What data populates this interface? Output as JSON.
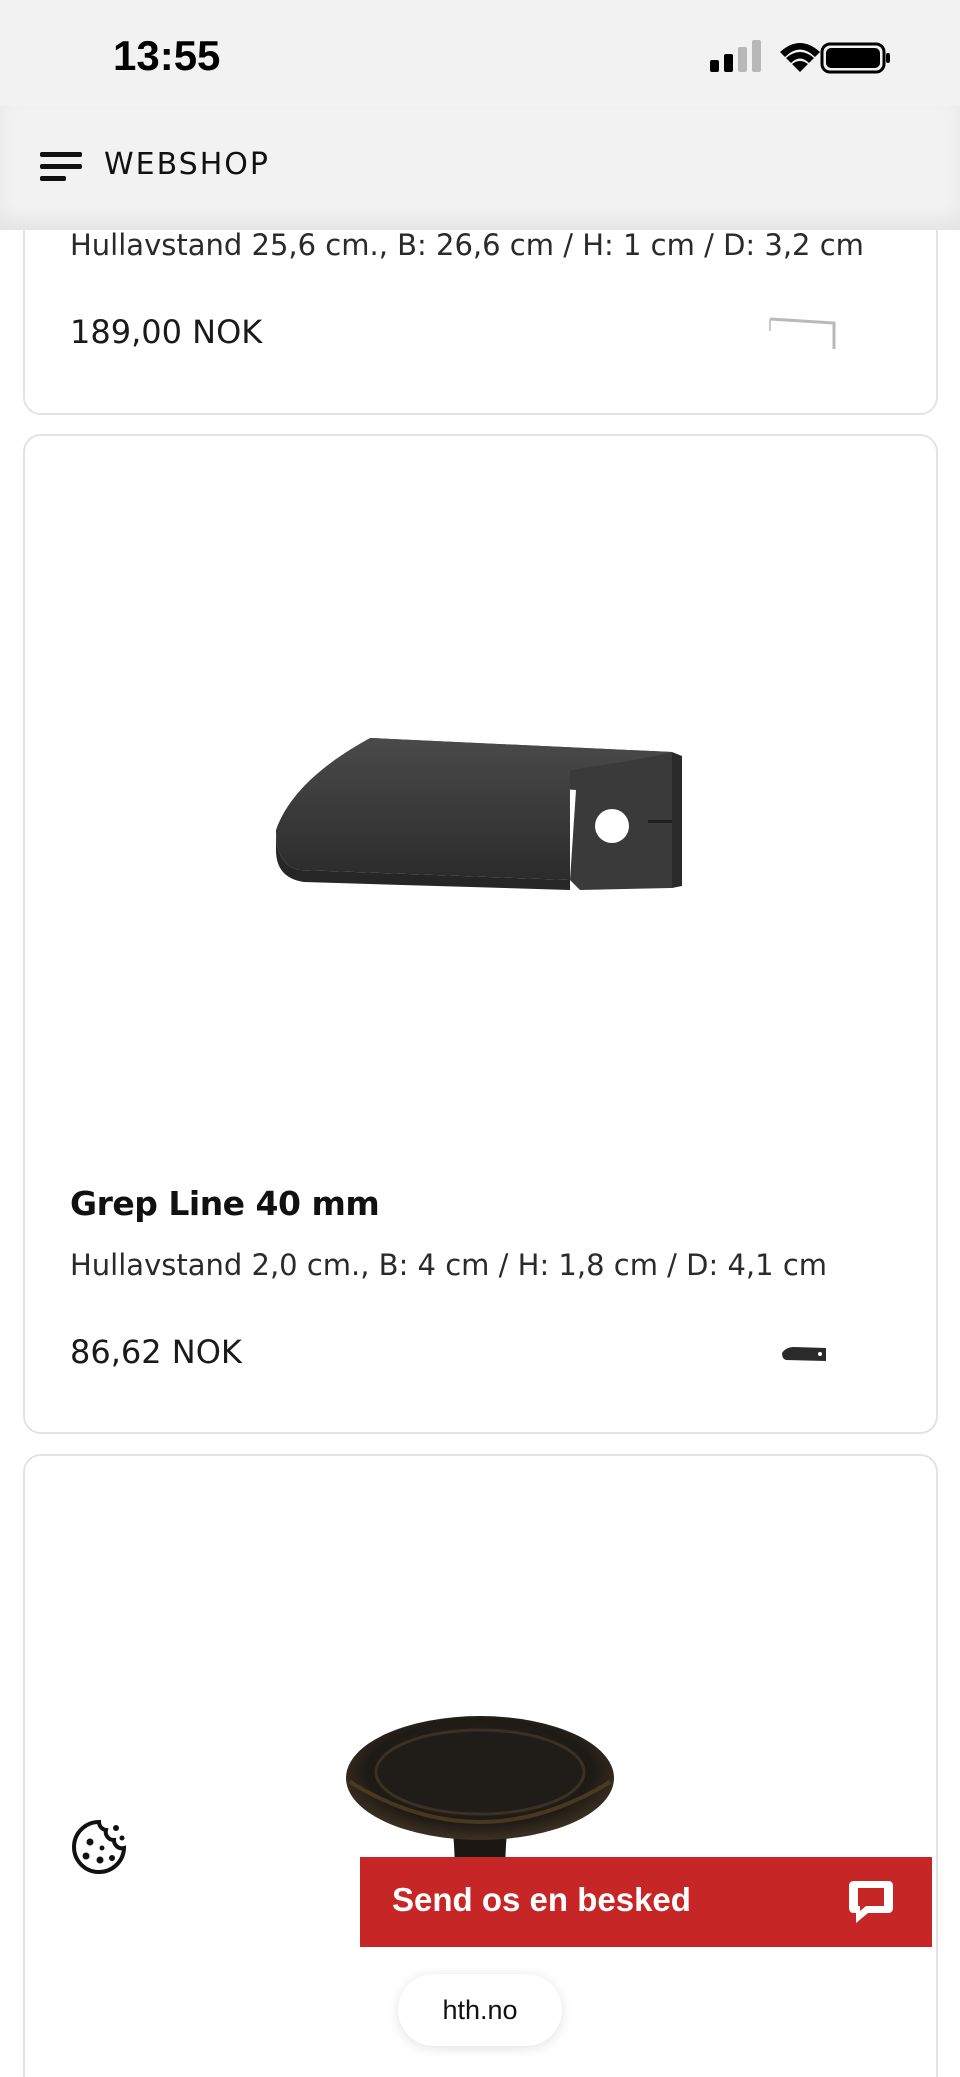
{
  "status_bar": {
    "time": "13:55",
    "icons": [
      "signal-icon",
      "wifi-icon",
      "battery-icon"
    ]
  },
  "header": {
    "title": "WEBSHOP",
    "menu_icon": "menu-icon"
  },
  "products": [
    {
      "title": "",
      "description": "Hullavstand 25,6 cm., B: 26,6 cm / H: 1 cm / D: 3,2 cm",
      "price": "189,00 NOK"
    },
    {
      "title": "Grep Line 40 mm",
      "description": "Hullavstand 2,0 cm., B: 4 cm / H: 1,8 cm / D: 4,1 cm",
      "price": "86,62 NOK"
    },
    {
      "title": "",
      "description": "",
      "price": ""
    }
  ],
  "chat": {
    "label": "Send os en besked",
    "icon": "chat-bubble-icon"
  },
  "browser": {
    "url": "hth.no"
  },
  "colors": {
    "accent": "#c62626",
    "background": "#ffffff",
    "header": "#f2f2f2"
  }
}
